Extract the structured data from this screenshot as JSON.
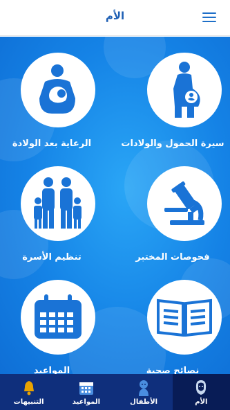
{
  "header": {
    "title": "الأم"
  },
  "tiles": [
    {
      "label": "سيرة الحمول والولادات",
      "icon": "pregnant-woman-icon"
    },
    {
      "label": "الرعاية بعد الولادة",
      "icon": "breastfeeding-icon"
    },
    {
      "label": "فحوصات المختبر",
      "icon": "microscope-icon"
    },
    {
      "label": "تنظيم الأسرة",
      "icon": "family-icon"
    },
    {
      "label": "نصائح صحية",
      "icon": "open-book-icon"
    },
    {
      "label": "المواعيد",
      "icon": "calendar-icon"
    }
  ],
  "bottom_nav": [
    {
      "label": "الأم",
      "icon": "mother-icon",
      "active": true
    },
    {
      "label": "الأطفال",
      "icon": "baby-icon",
      "active": false
    },
    {
      "label": "المواعيد",
      "icon": "calendar-icon",
      "active": false
    },
    {
      "label": "التنبيهات",
      "icon": "bell-icon",
      "active": false
    }
  ],
  "colors": {
    "header_bg": "#ffffff",
    "title": "#1e5fb4",
    "main_bg": "#1583e6",
    "icon": "#1a73d6",
    "nav_bg": "#0f2f7c",
    "nav_active": "#081c56"
  }
}
